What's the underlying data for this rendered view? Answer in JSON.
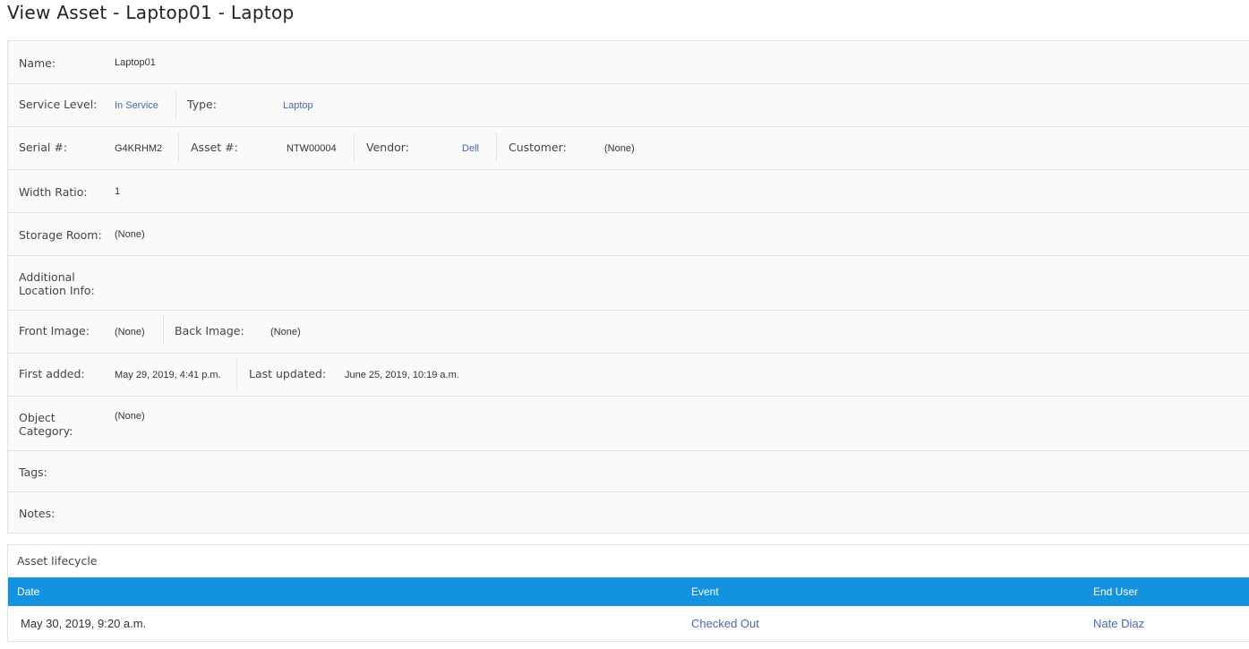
{
  "page": {
    "title": "View Asset - Laptop01 - Laptop"
  },
  "details": {
    "name": {
      "label": "Name:",
      "value": "Laptop01"
    },
    "service_level": {
      "label": "Service Level:",
      "value": "In Service"
    },
    "type": {
      "label": "Type:",
      "value": "Laptop"
    },
    "serial": {
      "label": "Serial #:",
      "value": "G4KRHM2"
    },
    "asset_no": {
      "label": "Asset #:",
      "value": "NTW00004"
    },
    "vendor": {
      "label": "Vendor:",
      "value": "Dell"
    },
    "customer": {
      "label": "Customer:",
      "value": "(None)"
    },
    "width_ratio": {
      "label": "Width Ratio:",
      "value": "1"
    },
    "storage_room": {
      "label": "Storage Room:",
      "value": "(None)"
    },
    "additional_location": {
      "label_line1": "Additional",
      "label_line2": "Location Info:",
      "value": ""
    },
    "front_image": {
      "label": "Front Image:",
      "value": "(None)"
    },
    "back_image": {
      "label": "Back Image:",
      "value": "(None)"
    },
    "first_added": {
      "label": "First added:",
      "value": "May 29, 2019, 4:41 p.m."
    },
    "last_updated": {
      "label": "Last updated:",
      "value": "June 25, 2019, 10:19 a.m."
    },
    "object_category": {
      "label_line1": "Object",
      "label_line2": "Category:",
      "value": "(None)"
    },
    "tags": {
      "label": "Tags:",
      "value": ""
    },
    "notes": {
      "label": "Notes:",
      "value": ""
    }
  },
  "lifecycle": {
    "title": "Asset lifecycle",
    "columns": [
      "Date",
      "Event",
      "End User"
    ],
    "rows": [
      {
        "date": "May 30, 2019, 9:20 a.m.",
        "event": "Checked Out",
        "end_user": "Nate Diaz"
      }
    ],
    "header_color": "#1392e0",
    "link_color": "#4a68a8"
  }
}
